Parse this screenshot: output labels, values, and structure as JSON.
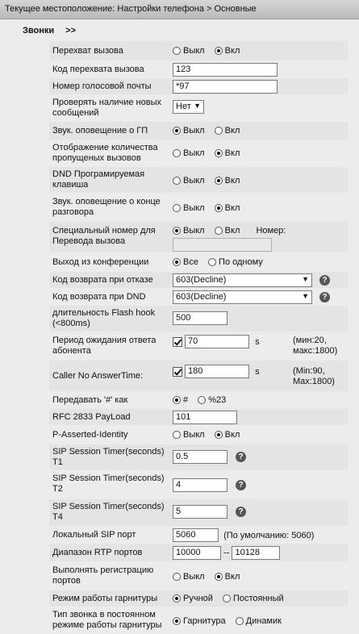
{
  "breadcrumb": "Текущее местоположение: Настройки телефона > Основные",
  "section": {
    "title": "Звонки",
    "arrow": ">>"
  },
  "common": {
    "off": "Выкл",
    "on": "Вкл"
  },
  "fields": {
    "call_pickup": "Перехват вызова",
    "pickup_code": {
      "label": "Код перехвата вызова",
      "value": "123"
    },
    "voicemail_number": {
      "label": "Номер голосовой почты",
      "value": "*97"
    },
    "check_new_messages": {
      "label": "Проверять наличие новых сообщений",
      "value": "Нет"
    },
    "vm_sound_alert": "Звук. оповещение о ГП",
    "missed_calls_display": "Отображение количества пропущеных вызовов",
    "dnd_programmable_key": "DND Програмируемая клавиша",
    "end_call_sound": "Звук. оповещение о конце разговора",
    "special_transfer": {
      "label": "Специальный номер для Перевода вызова",
      "number_label": "Номер:"
    },
    "conference_exit": {
      "label": "Выход из конференции",
      "opt_all": "Все",
      "opt_one": "По одному"
    },
    "reject_return_code": {
      "label": "Код возврата при отказе",
      "value": "603(Decline)"
    },
    "dnd_return_code": {
      "label": "Код возврата при DND",
      "value": "603(Decline)"
    },
    "flash_hook": {
      "label": "длительность Flash hook (<800ms)",
      "value": "500"
    },
    "answer_timeout": {
      "label": "Период ожидания ответа абонента",
      "value": "70",
      "unit": "s",
      "range": "(мин:20, макс:1800)"
    },
    "caller_no_answer": {
      "label": "Caller No AnswerTime:",
      "value": "180",
      "unit": "s",
      "range": "(Min:90, Max:1800)"
    },
    "send_hash": {
      "label": "Передавать '#' как",
      "opt1": "#",
      "opt2": "%23"
    },
    "rfc2833": {
      "label": "RFC 2833 PayLoad",
      "value": "101"
    },
    "p_asserted": "P-Asserted-Identity",
    "sip_timer_t1": {
      "label": "SIP Session Timer(seconds) T1",
      "value": "0.5"
    },
    "sip_timer_t2": {
      "label": "SIP Session Timer(seconds) T2",
      "value": "4"
    },
    "sip_timer_t4": {
      "label": "SIP Session Timer(seconds) T4",
      "value": "5"
    },
    "local_sip_port": {
      "label": "Локальный SIP порт",
      "value": "5060",
      "default_note": "(По умолчанию: 5060)"
    },
    "rtp_range": {
      "label": "Диапазон RTP портов",
      "from": "10000",
      "sep": "--",
      "to": "10128"
    },
    "port_registration": "Выполнять регистрацию портов",
    "headset_mode": {
      "label": "Режим работы гарнитуры",
      "opt1": "Ручной",
      "opt2": "Постоянный"
    },
    "ring_type": {
      "label": "Тип звонка в постоянном режиме работы гарнитуры",
      "opt1": "Гарнитура",
      "opt2": "Динамик"
    }
  }
}
